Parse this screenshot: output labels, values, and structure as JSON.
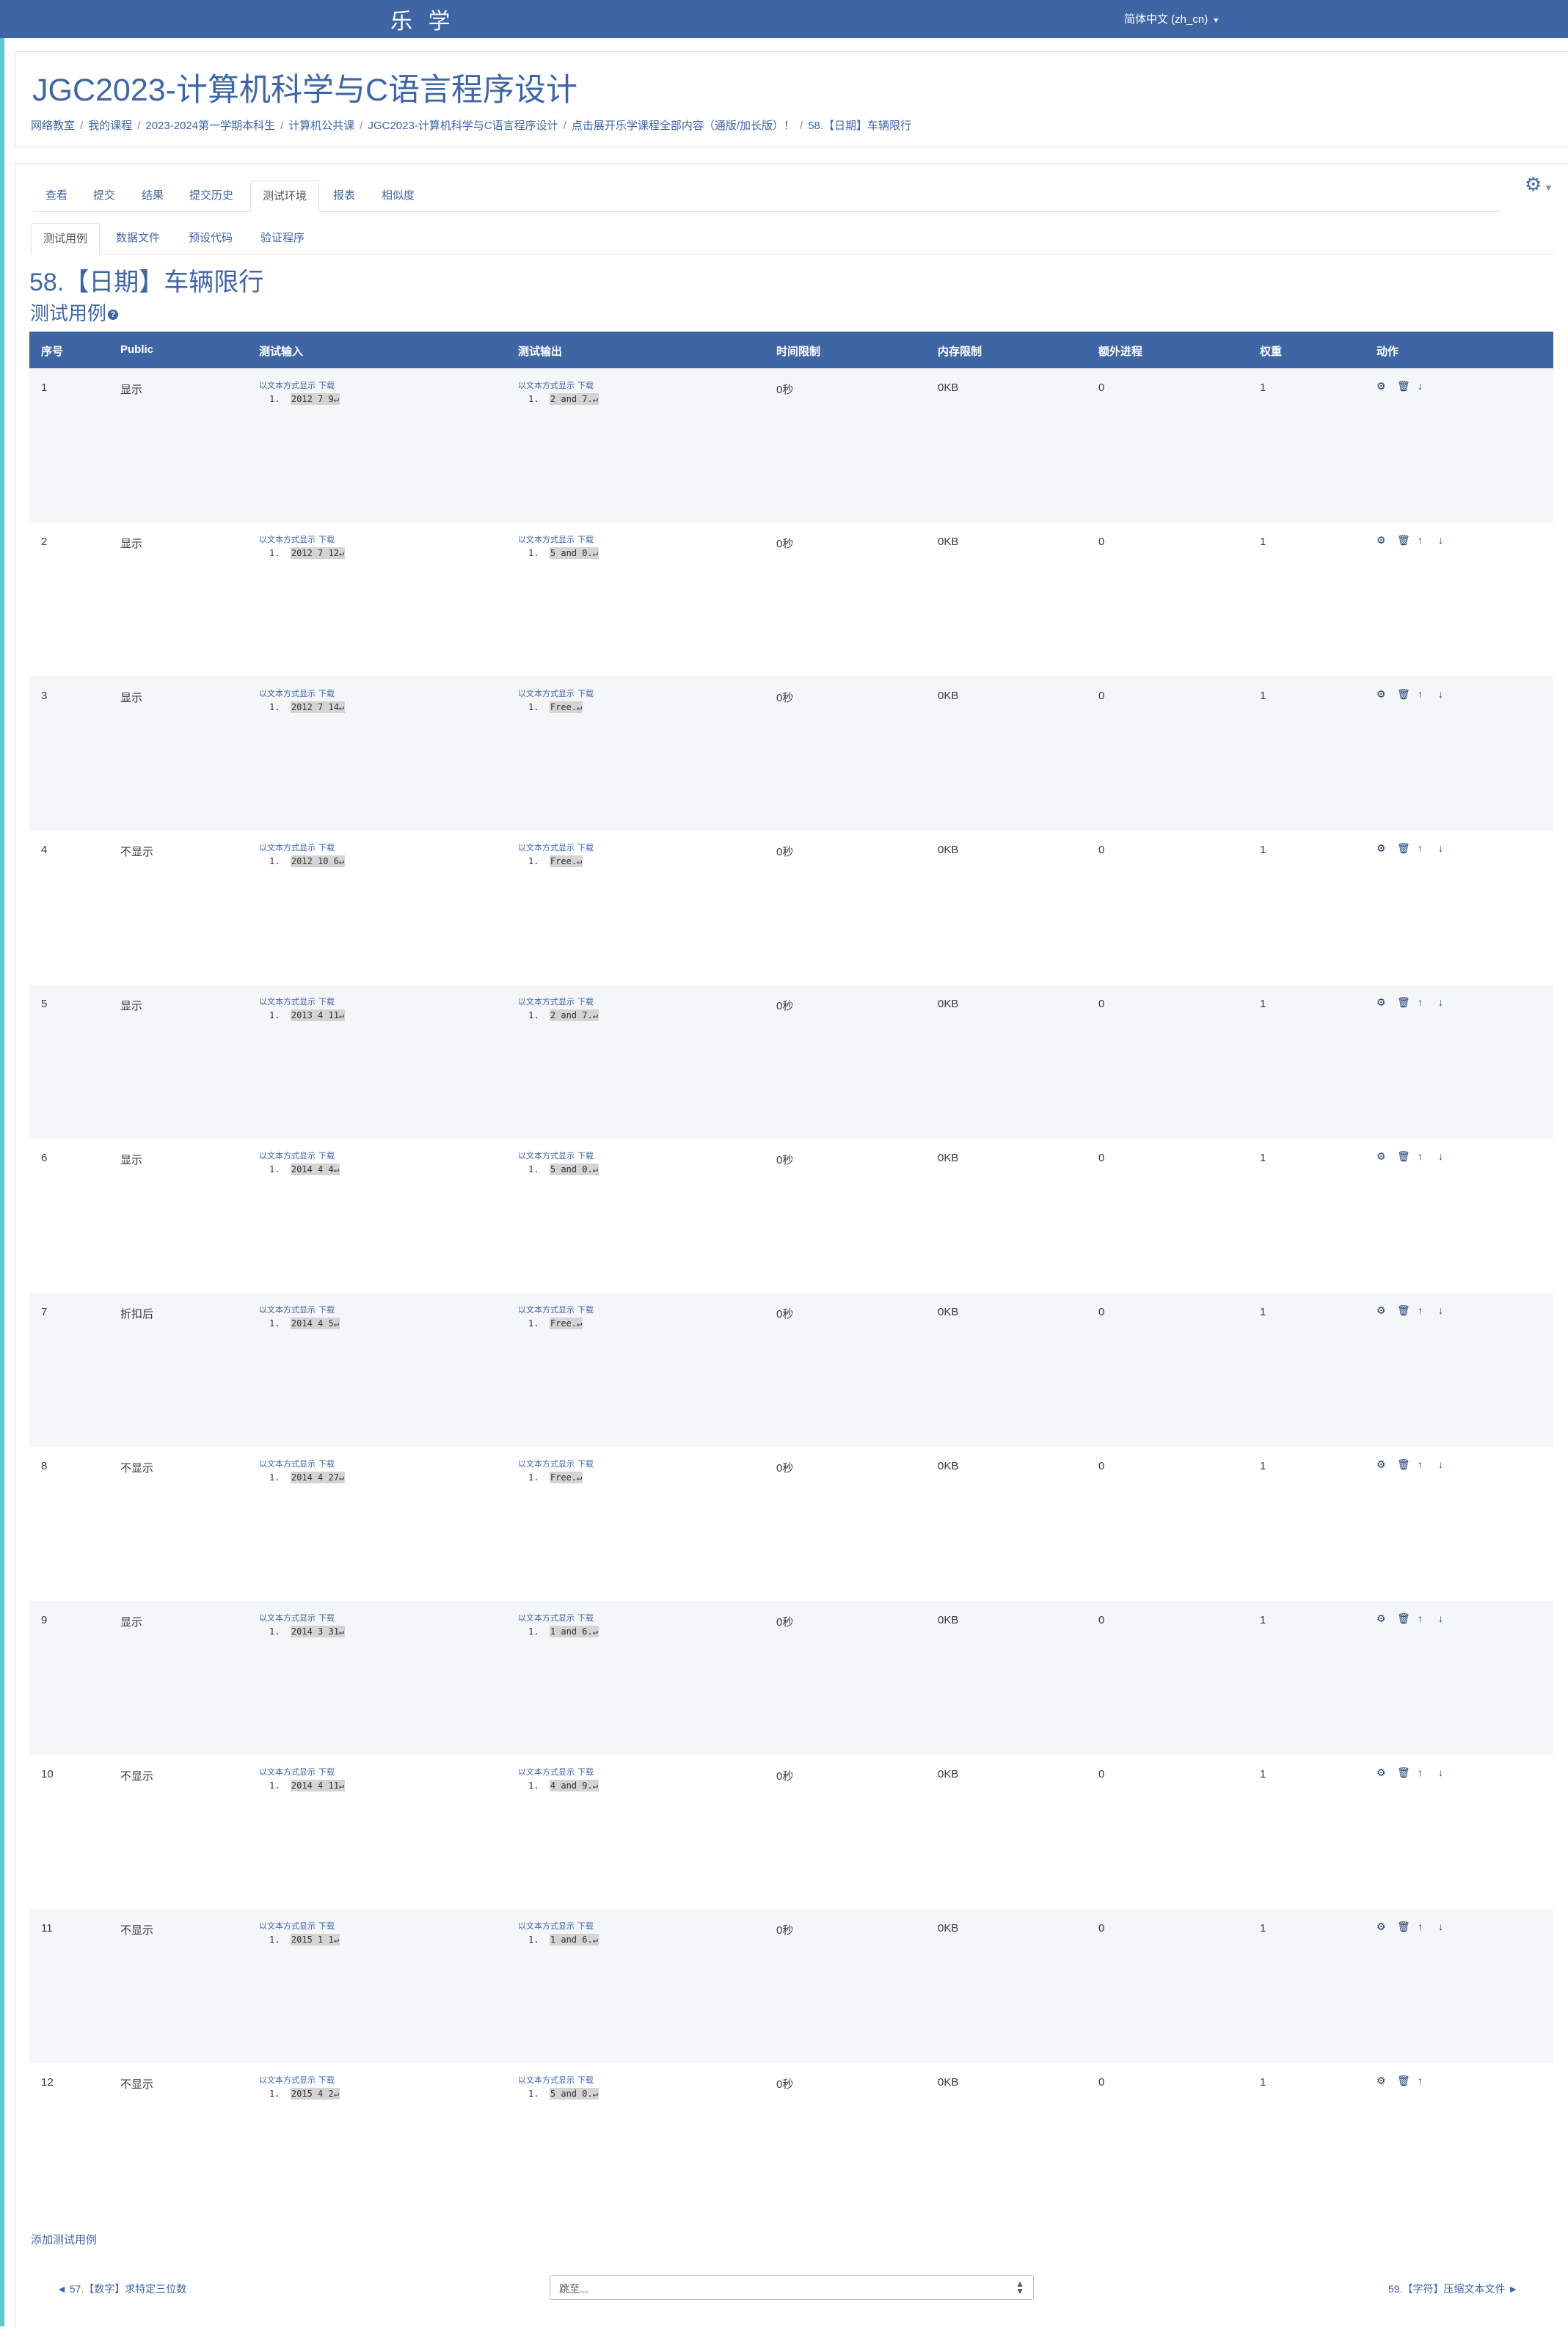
{
  "navbar": {
    "brand": "乐 学",
    "language": "简体中文 (zh_cn)"
  },
  "course": {
    "title": "JGC2023-计算机科学与C语言程序设计"
  },
  "breadcrumb": [
    "网络教室",
    "我的课程",
    "2023-2024第一学期本科生",
    "计算机公共课",
    "JGC2023-计算机科学与C语言程序设计",
    "点击展开乐学课程全部内容（通版/加长版）！",
    "58.【日期】车辆限行"
  ],
  "tabs_primary": [
    "查看",
    "提交",
    "结果",
    "提交历史",
    "测试环境",
    "报表",
    "相似度"
  ],
  "tabs_secondary": [
    "测试用例",
    "数据文件",
    "预设代码",
    "验证程序"
  ],
  "page": {
    "title": "58.【日期】车辆限行",
    "subtitle": "测试用例",
    "help": "?"
  },
  "table": {
    "headers": [
      "序号",
      "Public",
      "测试输入",
      "测试输出",
      "时间限制",
      "内存限制",
      "额外进程",
      "权重",
      "动作"
    ],
    "link_text": "以文本方式显示",
    "download_text": "下载",
    "rows": [
      {
        "n": "1",
        "pub": "显示",
        "input": "2012 7 9↵",
        "output": "2 and 7.↵",
        "time": "0秒",
        "mem": "0KB",
        "proc": "0",
        "weight": "1",
        "actions": "⚙ 🗑 ↓"
      },
      {
        "n": "2",
        "pub": "显示",
        "input": "2012 7 12↵",
        "output": "5 and 0.↵",
        "time": "0秒",
        "mem": "0KB",
        "proc": "0",
        "weight": "1",
        "actions": "⚙ 🗑 ↑ ↓"
      },
      {
        "n": "3",
        "pub": "显示",
        "input": "2012 7 14↵",
        "output": "Free.↵",
        "time": "0秒",
        "mem": "0KB",
        "proc": "0",
        "weight": "1",
        "actions": "⚙ 🗑 ↑ ↓"
      },
      {
        "n": "4",
        "pub": "不显示",
        "input": "2012 10 6↵",
        "output": "Free.↵",
        "time": "0秒",
        "mem": "0KB",
        "proc": "0",
        "weight": "1",
        "actions": "⚙ 🗑 ↑ ↓"
      },
      {
        "n": "5",
        "pub": "显示",
        "input": "2013 4 11↵",
        "output": "2 and 7.↵",
        "time": "0秒",
        "mem": "0KB",
        "proc": "0",
        "weight": "1",
        "actions": "⚙ 🗑 ↑ ↓"
      },
      {
        "n": "6",
        "pub": "显示",
        "input": "2014 4 4↵",
        "output": "5 and 0.↵",
        "time": "0秒",
        "mem": "0KB",
        "proc": "0",
        "weight": "1",
        "actions": "⚙ 🗑 ↑ ↓"
      },
      {
        "n": "7",
        "pub": "折扣后",
        "input": "2014 4 5↵",
        "output": "Free.↵",
        "time": "0秒",
        "mem": "0KB",
        "proc": "0",
        "weight": "1",
        "actions": "⚙ 🗑 ↑ ↓"
      },
      {
        "n": "8",
        "pub": "不显示",
        "input": "2014 4 27↵",
        "output": "Free.↵",
        "time": "0秒",
        "mem": "0KB",
        "proc": "0",
        "weight": "1",
        "actions": "⚙ 🗑 ↑ ↓"
      },
      {
        "n": "9",
        "pub": "显示",
        "input": "2014 3 31↵",
        "output": "1 and 6.↵",
        "time": "0秒",
        "mem": "0KB",
        "proc": "0",
        "weight": "1",
        "actions": "⚙ 🗑 ↑ ↓"
      },
      {
        "n": "10",
        "pub": "不显示",
        "input": "2014 4 11↵",
        "output": "4 and 9.↵",
        "time": "0秒",
        "mem": "0KB",
        "proc": "0",
        "weight": "1",
        "actions": "⚙ 🗑 ↑ ↓"
      },
      {
        "n": "11",
        "pub": "不显示",
        "input": "2015 1 1↵",
        "output": "1 and 6.↵",
        "time": "0秒",
        "mem": "0KB",
        "proc": "0",
        "weight": "1",
        "actions": "⚙ 🗑 ↑ ↓"
      },
      {
        "n": "12",
        "pub": "不显示",
        "input": "2015 4 2↵",
        "output": "5 and 0.↵",
        "time": "0秒",
        "mem": "0KB",
        "proc": "0",
        "weight": "1",
        "actions": "⚙ 🗑 ↑"
      }
    ]
  },
  "footer": {
    "add_test": "添加测试用例",
    "prev": "◄ 57.【数字】求特定三位数",
    "next": "59.【字符】压缩文本文件 ►",
    "jump_placeholder": "跳至..."
  },
  "colors": {
    "brand": "#3f66a3",
    "stripe": "#f5f6f8",
    "left_accent": "#5bc7d2"
  }
}
